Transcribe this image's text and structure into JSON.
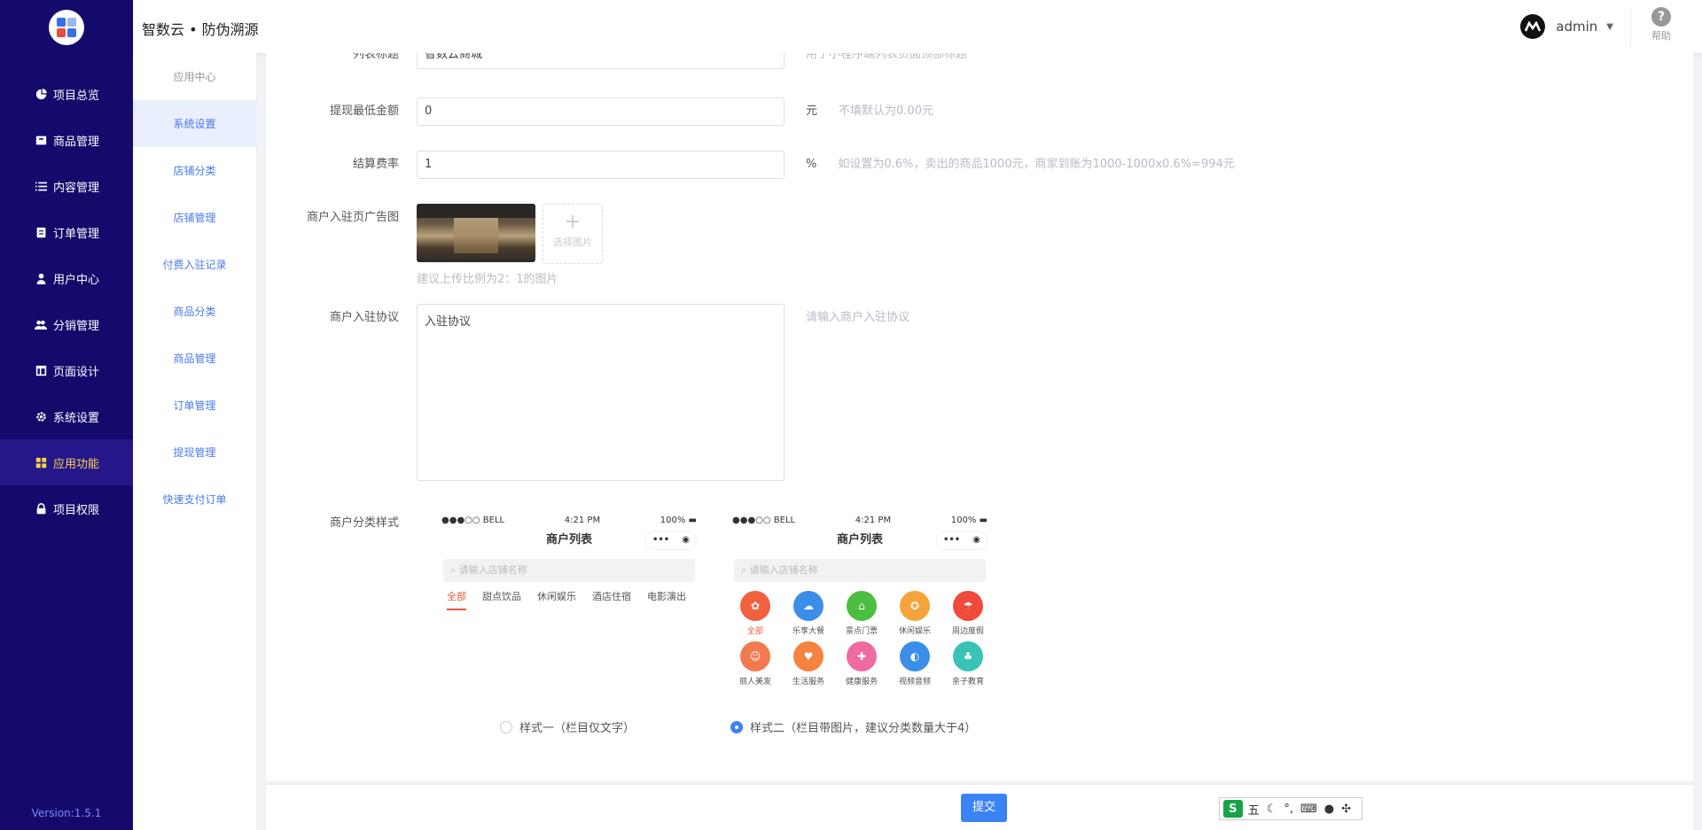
{
  "header": {
    "title": "智数云 • 防伪溯源",
    "user": "admin",
    "help": "帮助"
  },
  "sidebar": {
    "items": [
      {
        "label": "项目总览",
        "icon": "pie-chart-icon"
      },
      {
        "label": "商品管理",
        "icon": "box-icon"
      },
      {
        "label": "内容管理",
        "icon": "list-icon"
      },
      {
        "label": "订单管理",
        "icon": "clipboard-icon"
      },
      {
        "label": "用户中心",
        "icon": "user-icon"
      },
      {
        "label": "分销管理",
        "icon": "users-icon"
      },
      {
        "label": "页面设计",
        "icon": "layout-icon"
      },
      {
        "label": "系统设置",
        "icon": "gear-icon"
      },
      {
        "label": "应用功能",
        "icon": "grid-icon"
      },
      {
        "label": "项目权限",
        "icon": "lock-icon"
      }
    ],
    "version": "Version:1.5.1"
  },
  "subnav": {
    "items": [
      "应用中心",
      "系统设置",
      "店铺分类",
      "店铺管理",
      "付费入驻记录",
      "商品分类",
      "商品管理",
      "订单管理",
      "提现管理",
      "快速支付订单"
    ]
  },
  "form": {
    "list_title": {
      "label": "列表标题",
      "value": "智数云商城",
      "hint": "用于小程序端列表页面顶部标题"
    },
    "min_withdraw": {
      "label": "提现最低金额",
      "value": "0",
      "unit": "元",
      "hint": "不填默认为0.00元"
    },
    "settle_rate": {
      "label": "结算费率",
      "value": "1",
      "unit": "%",
      "hint": "如设置为0.6%，卖出的商品1000元，商家到账为1000-1000x0.6%=994元"
    },
    "ad_image": {
      "label": "商户入驻页广告图",
      "upload_text": "选择图片",
      "hint": "建议上传比例为2：1的图片"
    },
    "agreement": {
      "label": "商户入驻协议",
      "value": "入驻协议",
      "hint": "请输入商户入驻协议"
    },
    "category_style": {
      "label": "商户分类样式",
      "option1": "样式一（栏目仅文字）",
      "option2": "样式二（栏目带图片，建议分类数量大于4）",
      "selected": 2
    }
  },
  "phone": {
    "carrier": "●●●○○ BELL",
    "time": "4:21 PM",
    "battery": "100%",
    "title": "商户列表",
    "search_placeholder": "请输入店铺名称",
    "tabs": [
      "全部",
      "甜点饮品",
      "休闲娱乐",
      "酒店住宿",
      "电影演出"
    ],
    "grid": [
      {
        "label": "全部",
        "color": "#f0623f"
      },
      {
        "label": "乐享大餐",
        "color": "#3b8ee8"
      },
      {
        "label": "景点门票",
        "color": "#4cbe3f"
      },
      {
        "label": "休闲娱乐",
        "color": "#f5a33c"
      },
      {
        "label": "周边度假",
        "color": "#ef4a3c"
      },
      {
        "label": "丽人美发",
        "color": "#f27a4e"
      },
      {
        "label": "生活服务",
        "color": "#f5823e"
      },
      {
        "label": "健康服务",
        "color": "#ef6b9f"
      },
      {
        "label": "视频音频",
        "color": "#3b8ee8"
      },
      {
        "label": "亲子教育",
        "color": "#39c3b6"
      }
    ]
  },
  "footer": {
    "submit": "提交",
    "ime_label": "五"
  }
}
